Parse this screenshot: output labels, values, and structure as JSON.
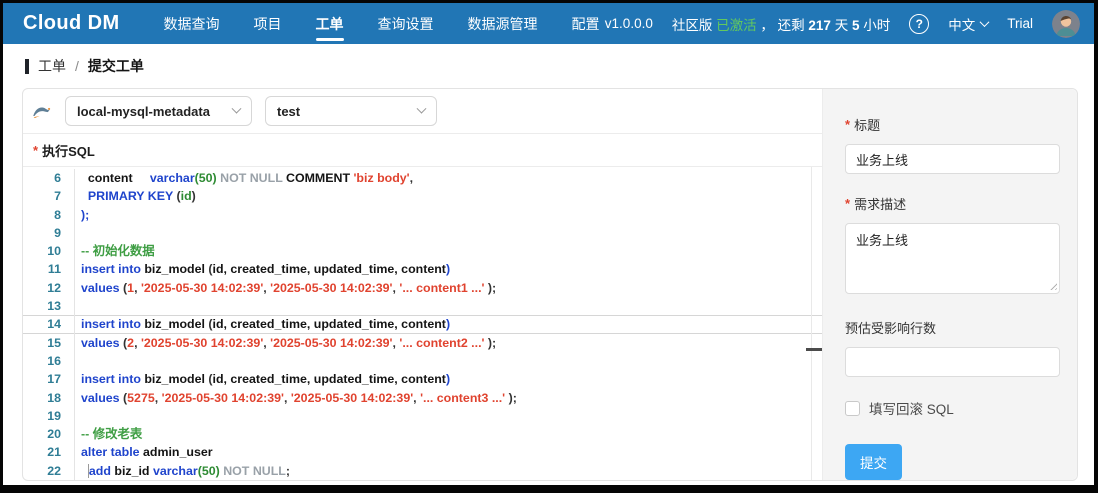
{
  "nav": {
    "logo": "Cloud DM",
    "items": [
      {
        "label": "数据查询"
      },
      {
        "label": "项目"
      },
      {
        "label": "工单"
      },
      {
        "label": "查询设置"
      },
      {
        "label": "数据源管理"
      },
      {
        "label": "配置"
      }
    ],
    "version": "v1.0.0.0",
    "edition": "社区版",
    "activated": "已激活",
    "remain_pre": "， 还剩",
    "remain_days": "217",
    "days_unit": "天",
    "remain_hours": "5",
    "hours_unit": "小时",
    "help_icon": "?",
    "lang": "中文",
    "trial": "Trial"
  },
  "breadcrumb": {
    "section": "工单",
    "sep": "/",
    "page": "提交工单"
  },
  "toolbar": {
    "datasource": "local-mysql-metadata",
    "database": "test"
  },
  "sql_header": {
    "required_mark": "*",
    "label": "执行SQL"
  },
  "editor": {
    "lines": [
      {
        "num": 6,
        "segs": [
          {
            "t": "  ",
            "c": "pln"
          },
          {
            "t": "content",
            "c": "id"
          },
          {
            "t": "     ",
            "c": "pln"
          },
          {
            "t": "varchar",
            "c": "kw"
          },
          {
            "t": "(50)",
            "c": "numg"
          },
          {
            "t": " ",
            "c": "pln"
          },
          {
            "t": "NOT NULL",
            "c": "gray"
          },
          {
            "t": " ",
            "c": "pln"
          },
          {
            "t": "COMMENT",
            "c": "id"
          },
          {
            "t": " ",
            "c": "pln"
          },
          {
            "t": "'biz body'",
            "c": "str"
          },
          {
            "t": ",",
            "c": "pln"
          }
        ]
      },
      {
        "num": 7,
        "segs": [
          {
            "t": "  ",
            "c": "pln"
          },
          {
            "t": "PRIMARY KEY",
            "c": "kw"
          },
          {
            "t": " (",
            "c": "pln"
          },
          {
            "t": "id",
            "c": "numg"
          },
          {
            "t": ")",
            "c": "pln"
          }
        ]
      },
      {
        "num": 8,
        "segs": [
          {
            "t": ");",
            "c": "kw"
          }
        ]
      },
      {
        "num": 9,
        "segs": []
      },
      {
        "num": 10,
        "segs": [
          {
            "t": "-- 初始化数据",
            "c": "com"
          }
        ]
      },
      {
        "num": 11,
        "segs": [
          {
            "t": "insert into",
            "c": "kw"
          },
          {
            "t": " ",
            "c": "pln"
          },
          {
            "t": "biz_model",
            "c": "id"
          },
          {
            "t": " (",
            "c": "pln"
          },
          {
            "t": "id, created_time, updated_time, content",
            "c": "id"
          },
          {
            "t": ")",
            "c": "kw"
          }
        ]
      },
      {
        "num": 12,
        "segs": [
          {
            "t": "values",
            "c": "kw"
          },
          {
            "t": " (",
            "c": "pln"
          },
          {
            "t": "1",
            "c": "str"
          },
          {
            "t": ", ",
            "c": "pln"
          },
          {
            "t": "'2025-05-30 14:02:39'",
            "c": "str"
          },
          {
            "t": ", ",
            "c": "pln"
          },
          {
            "t": "'2025-05-30 14:02:39'",
            "c": "str"
          },
          {
            "t": ", ",
            "c": "pln"
          },
          {
            "t": "'... content1 ...'",
            "c": "str"
          },
          {
            "t": " );",
            "c": "pln"
          }
        ]
      },
      {
        "num": 13,
        "segs": []
      },
      {
        "num": 14,
        "active": true,
        "segs": [
          {
            "t": "insert into",
            "c": "kw"
          },
          {
            "t": " ",
            "c": "pln"
          },
          {
            "t": "biz_model",
            "c": "id"
          },
          {
            "t": " (",
            "c": "pln"
          },
          {
            "t": "id, created_time, updated_time, content",
            "c": "id"
          },
          {
            "t": ")",
            "c": "kw"
          }
        ]
      },
      {
        "num": 15,
        "segs": [
          {
            "t": "values",
            "c": "kw"
          },
          {
            "t": " (",
            "c": "pln"
          },
          {
            "t": "2",
            "c": "str"
          },
          {
            "t": ", ",
            "c": "pln"
          },
          {
            "t": "'2025-05-30 14:02:39'",
            "c": "str"
          },
          {
            "t": ", ",
            "c": "pln"
          },
          {
            "t": "'2025-05-30 14:02:39'",
            "c": "str"
          },
          {
            "t": ", ",
            "c": "pln"
          },
          {
            "t": "'... content2 ...'",
            "c": "str"
          },
          {
            "t": " );",
            "c": "pln"
          }
        ]
      },
      {
        "num": 16,
        "segs": []
      },
      {
        "num": 17,
        "segs": [
          {
            "t": "insert into",
            "c": "kw"
          },
          {
            "t": " ",
            "c": "pln"
          },
          {
            "t": "biz_model",
            "c": "id"
          },
          {
            "t": " (",
            "c": "pln"
          },
          {
            "t": "id, created_time, updated_time, content",
            "c": "id"
          },
          {
            "t": ")",
            "c": "kw"
          }
        ]
      },
      {
        "num": 18,
        "segs": [
          {
            "t": "values",
            "c": "kw"
          },
          {
            "t": " (",
            "c": "pln"
          },
          {
            "t": "5275",
            "c": "str"
          },
          {
            "t": ", ",
            "c": "pln"
          },
          {
            "t": "'2025-05-30 14:02:39'",
            "c": "str"
          },
          {
            "t": ", ",
            "c": "pln"
          },
          {
            "t": "'2025-05-30 14:02:39'",
            "c": "str"
          },
          {
            "t": ", ",
            "c": "pln"
          },
          {
            "t": "'... content3 ...'",
            "c": "str"
          },
          {
            "t": " );",
            "c": "pln"
          }
        ]
      },
      {
        "num": 19,
        "segs": []
      },
      {
        "num": 20,
        "segs": [
          {
            "t": "-- 修改老表",
            "c": "com"
          }
        ]
      },
      {
        "num": 21,
        "segs": [
          {
            "t": "alter table",
            "c": "kw"
          },
          {
            "t": " ",
            "c": "pln"
          },
          {
            "t": "admin_user",
            "c": "id"
          }
        ]
      },
      {
        "num": 22,
        "segs": [
          {
            "t": "  ",
            "c": "pln"
          },
          {
            "t": "add",
            "c": "kw",
            "guide": true
          },
          {
            "t": " ",
            "c": "pln"
          },
          {
            "t": "biz_id",
            "c": "id"
          },
          {
            "t": " ",
            "c": "pln"
          },
          {
            "t": "varchar",
            "c": "kw"
          },
          {
            "t": "(50)",
            "c": "numg"
          },
          {
            "t": " ",
            "c": "pln"
          },
          {
            "t": "NOT NULL",
            "c": "gray"
          },
          {
            "t": ";",
            "c": "pln"
          }
        ]
      }
    ]
  },
  "form": {
    "required_mark": "*",
    "title_label": "标题",
    "title_value": "业务上线",
    "desc_label": "需求描述",
    "desc_value": "业务上线",
    "rows_label": "预估受影响行数",
    "rows_value": "",
    "rollback_label": "填写回滚 SQL",
    "submit_label": "提交"
  },
  "colors": {
    "nav_bg": "#2176b5",
    "accent_button": "#3da7f3",
    "activated_green": "#62c95e",
    "keyword_blue": "#1f44cc",
    "string_red": "#e0432f",
    "comment_green": "#3f9e44",
    "line_number_teal": "#2f7d95"
  }
}
